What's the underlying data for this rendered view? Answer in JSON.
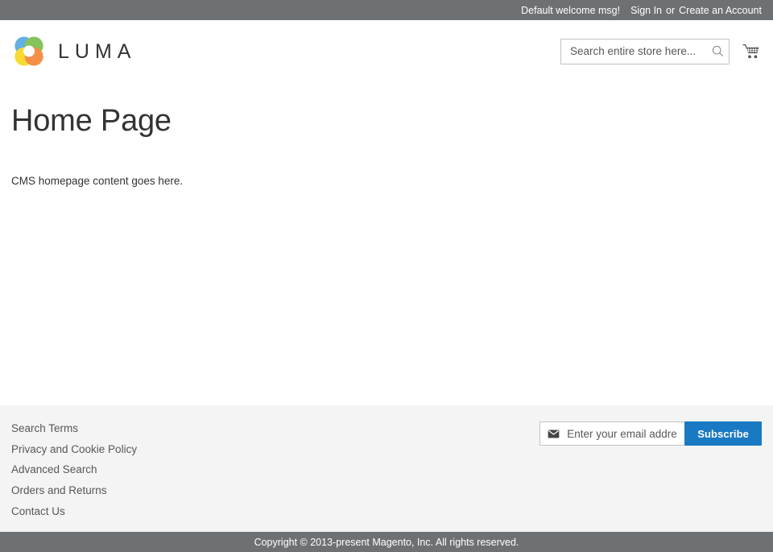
{
  "top_panel": {
    "welcome_message": "Default welcome msg!",
    "sign_in_label": "Sign In",
    "separator": "or",
    "create_account_label": "Create an Account"
  },
  "header": {
    "logo_text": "LUMA",
    "logo_icon": "luma-flower-logo",
    "logo_colors": {
      "blue": "#4ea6dd",
      "green": "#76bc45",
      "yellow": "#f9d616",
      "orange": "#f2802e"
    },
    "search": {
      "placeholder": "Search entire store here...",
      "value": "",
      "icon": "search-icon"
    },
    "cart": {
      "icon": "shopping-cart-icon",
      "count": ""
    }
  },
  "main": {
    "page_title": "Home Page",
    "cms_content": "CMS homepage content goes here."
  },
  "footer": {
    "links": [
      {
        "label": "Search Terms"
      },
      {
        "label": "Privacy and Cookie Policy"
      },
      {
        "label": "Advanced Search"
      },
      {
        "label": "Orders and Returns"
      },
      {
        "label": "Contact Us"
      }
    ],
    "newsletter": {
      "icon": "envelope-icon",
      "placeholder": "Enter your email address",
      "value": "",
      "subscribe_label": "Subscribe",
      "subscribe_color": "#1979c3"
    }
  },
  "copyright": {
    "text": "Copyright © 2013-present Magento, Inc. All rights reserved."
  }
}
